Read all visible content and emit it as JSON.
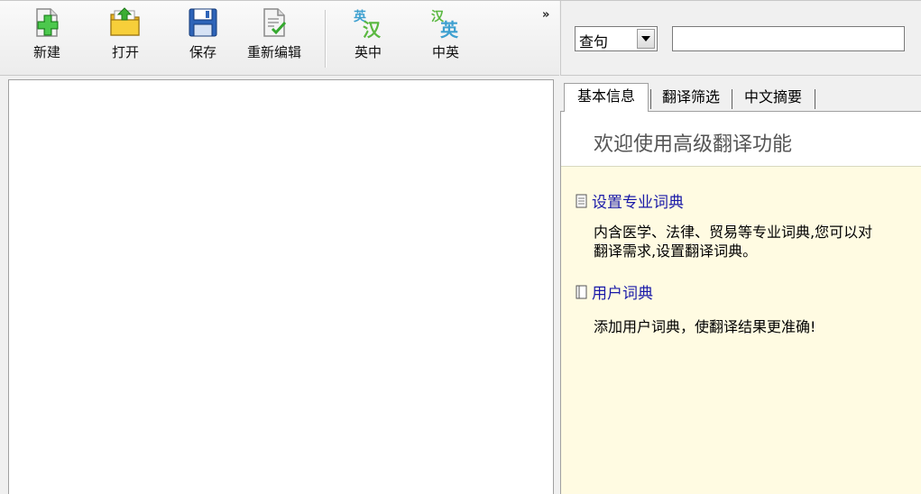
{
  "toolbar": {
    "buttons": [
      {
        "label": "新建",
        "icon": "new-icon"
      },
      {
        "label": "打开",
        "icon": "open-folder-icon"
      },
      {
        "label": "保存",
        "icon": "save-disk-icon"
      },
      {
        "label": "重新编辑",
        "icon": "edit-document-icon"
      },
      {
        "label": "英中",
        "icon": "en-to-zh-icon"
      },
      {
        "label": "中英",
        "icon": "zh-to-en-icon"
      }
    ],
    "overflow": "»"
  },
  "search": {
    "mode_value": "查句",
    "input_value": ""
  },
  "tabs": [
    {
      "label": "基本信息",
      "active": true
    },
    {
      "label": "翻译筛选",
      "active": false
    },
    {
      "label": "中文摘要",
      "active": false
    }
  ],
  "panel": {
    "title": "欢迎使用高级翻译功能",
    "sections": [
      {
        "link": "设置专业词典",
        "body_line1": "内含医学、法律、贸易等专业词典,您可以对",
        "body_line2": "翻译需求,设置翻译词典。"
      },
      {
        "link": "用户词典",
        "body_line1": "添加用户词典，使翻译结果更准确!"
      }
    ]
  },
  "colors": {
    "panel_background": "#fffbe2",
    "link": "#1a1aa8"
  }
}
